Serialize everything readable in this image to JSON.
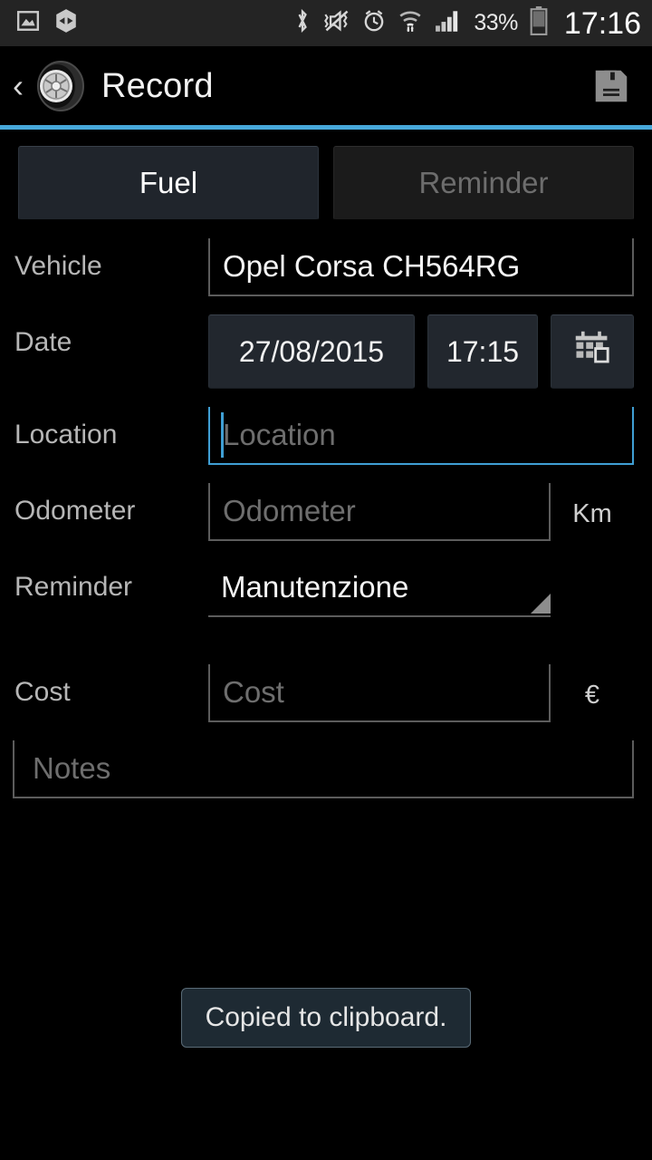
{
  "status_bar": {
    "left_icons": [
      "image-icon",
      "hexagon-icon"
    ],
    "right_icons": [
      "bluetooth-icon",
      "vibrate-mute-icon",
      "alarm-icon",
      "wifi-icon",
      "mobile-data-icon",
      "signal-icon"
    ],
    "battery_percent": "33%",
    "clock": "17:16"
  },
  "action_bar": {
    "back_label": "‹",
    "app_icon": "tire-icon",
    "title": "Record",
    "save_icon": "save-floppy-icon",
    "accent_color": "#47a8da"
  },
  "tabs": [
    {
      "label": "Fuel",
      "selected": true
    },
    {
      "label": "Reminder",
      "selected": false
    }
  ],
  "form": {
    "vehicle": {
      "label": "Vehicle",
      "value": "Opel Corsa CH564RG"
    },
    "date": {
      "label": "Date",
      "date_value": "27/08/2015",
      "time_value": "17:15",
      "calendar_icon": "calendar-icon"
    },
    "location": {
      "label": "Location",
      "value": "",
      "placeholder": "Location",
      "focused": true,
      "focus_color": "#3f9fd4"
    },
    "odometer": {
      "label": "Odometer",
      "value": "",
      "placeholder": "Odometer",
      "unit": "Km"
    },
    "reminder": {
      "label": "Reminder",
      "value": "Manutenzione",
      "dropdown_icon": "spinner-triangle-icon"
    },
    "cost": {
      "label": "Cost",
      "value": "",
      "placeholder": "Cost",
      "unit": "€"
    },
    "notes": {
      "value": "",
      "placeholder": "Notes"
    }
  },
  "toast": {
    "message": "Copied to clipboard."
  }
}
